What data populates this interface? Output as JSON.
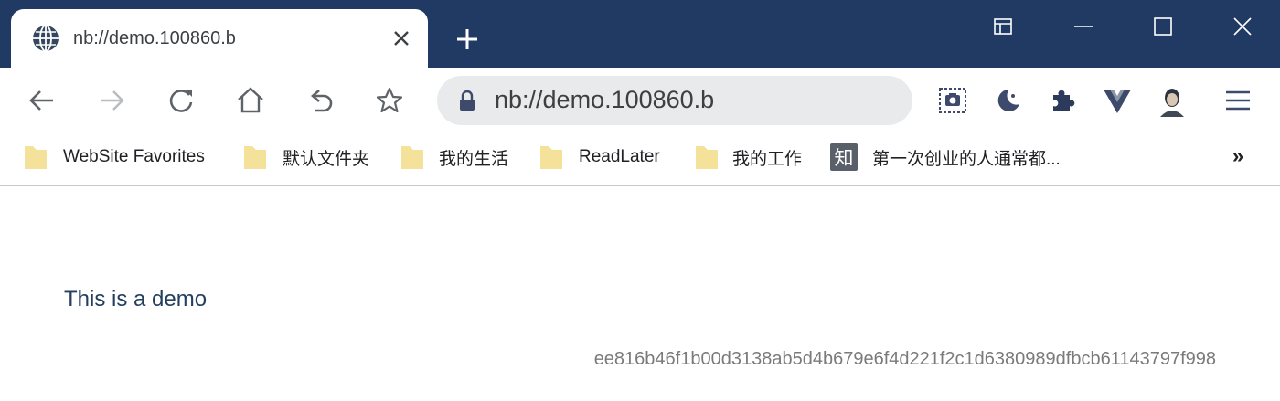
{
  "tab": {
    "title": "nb://demo.100860.b",
    "favicon": "globe-icon"
  },
  "omnibox": {
    "url": "nb://demo.100860.b"
  },
  "bookmarks": [
    {
      "label": "WebSite Favorites",
      "icon": "folder-icon"
    },
    {
      "label": "默认文件夹",
      "icon": "folder-icon"
    },
    {
      "label": "我的生活",
      "icon": "folder-icon"
    },
    {
      "label": "ReadLater",
      "icon": "folder-icon"
    },
    {
      "label": "我的工作",
      "icon": "folder-icon"
    },
    {
      "label": "第一次创业的人通常都...",
      "icon": "zhihu-icon",
      "icon_text": "知"
    }
  ],
  "bookmarks_more": "»",
  "content": {
    "text": "This is a demo",
    "hash": "ee816b46f1b00d3138ab5d4b679e6f4d221f2c1d6380989dfbcb61143797f998"
  },
  "colors": {
    "titlebar": "#213a63",
    "omnibox": "#e8eaec",
    "folder": "#f5e29a",
    "demo_text": "#233e5e"
  }
}
